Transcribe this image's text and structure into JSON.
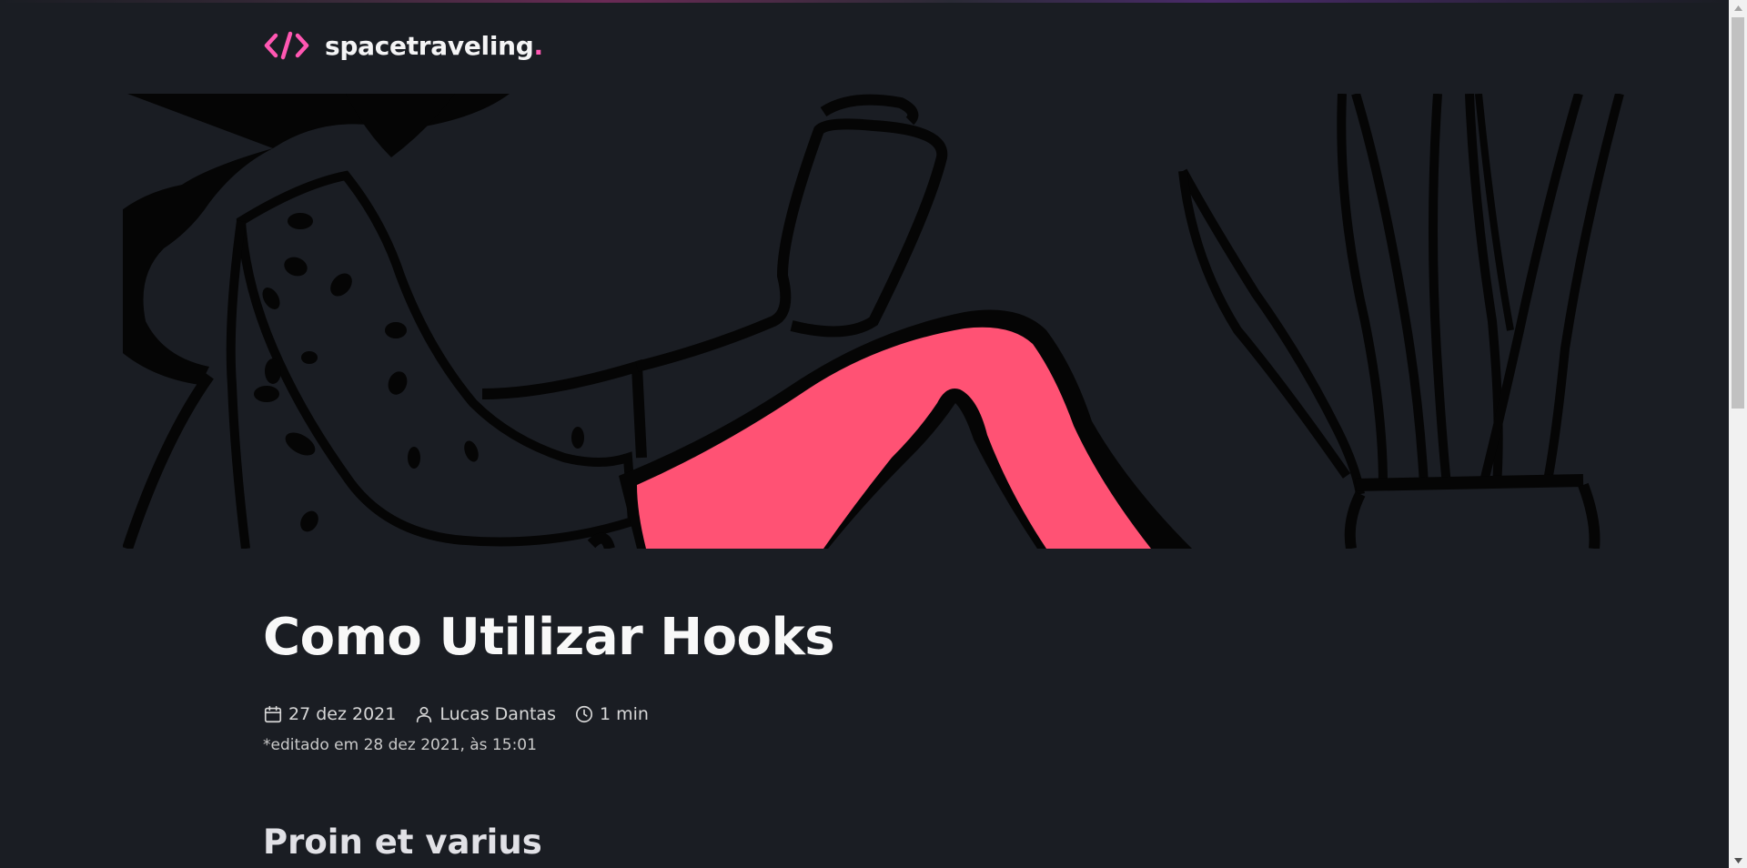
{
  "header": {
    "logo_icon": "code-brackets-icon",
    "brand_name": "spacetraveling",
    "brand_dot": ".",
    "brand_color": "#ff57b2"
  },
  "banner": {
    "image": "illustration-woman-reading-phone",
    "accent_color": "#ff5274"
  },
  "post": {
    "title": "Como Utilizar Hooks",
    "date": "27 dez 2021",
    "author": "Lucas Dantas",
    "reading_time": "1 min",
    "edited_note": "*editado em 28 dez 2021, às 15:01",
    "icons": {
      "date": "calendar-icon",
      "author": "user-icon",
      "reading_time": "clock-icon"
    },
    "sections": [
      {
        "heading": "Proin et varius"
      }
    ]
  },
  "colors": {
    "background": "#1a1d23",
    "title": "#f8f8f8",
    "meta_text": "#d7d7d7"
  }
}
